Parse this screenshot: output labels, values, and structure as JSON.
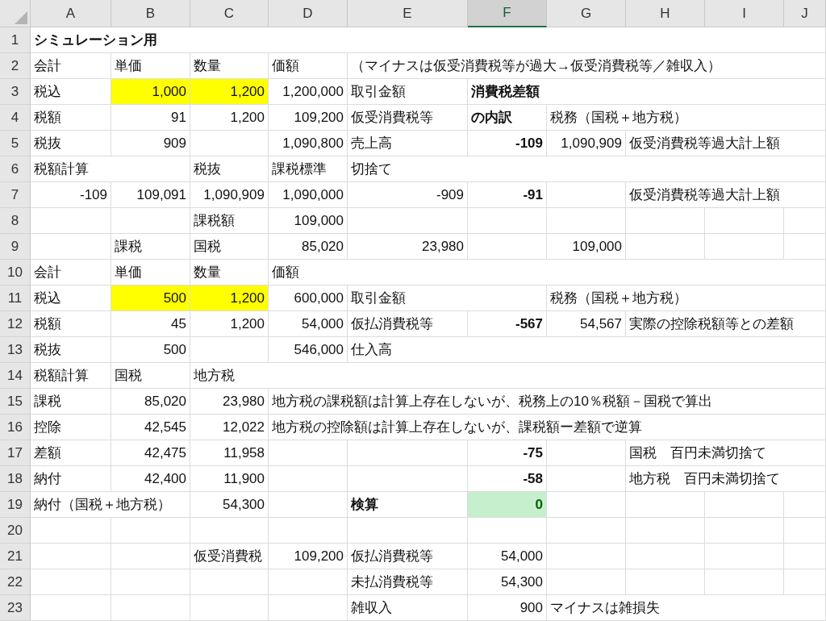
{
  "columns": [
    {
      "label": "A",
      "selected": false
    },
    {
      "label": "B",
      "selected": false
    },
    {
      "label": "C",
      "selected": false
    },
    {
      "label": "D",
      "selected": false
    },
    {
      "label": "E",
      "selected": false
    },
    {
      "label": "F",
      "selected": true
    },
    {
      "label": "G",
      "selected": false
    },
    {
      "label": "H",
      "selected": false
    },
    {
      "label": "I",
      "selected": false
    },
    {
      "label": "J",
      "selected": false
    }
  ],
  "rows": [
    {
      "number": "1",
      "A": {
        "text": "シミュレーション用",
        "bold": true
      }
    },
    {
      "number": "2",
      "A": {
        "text": "会計"
      },
      "B": {
        "text": "単価"
      },
      "C": {
        "text": "数量"
      },
      "D": {
        "text": "価額"
      },
      "E": {
        "text": "（マイナスは仮受消費税等が過大→仮受消費税等／雑収入）"
      }
    },
    {
      "number": "3",
      "A": {
        "text": "税込"
      },
      "B": {
        "text": "1,000",
        "right_aligned": true,
        "color": "#ffff00"
      },
      "C": {
        "text": "1,200",
        "right_aligned": true,
        "color": "#ffff00"
      },
      "D": {
        "text": "1,200,000",
        "right_aligned": true
      },
      "E": {
        "text": "取引金額"
      },
      "F": {
        "text": "消費税差額",
        "bold": true
      }
    },
    {
      "number": "4",
      "A": {
        "text": "税額"
      },
      "B": {
        "text": "91",
        "right_aligned": true
      },
      "C": {
        "text": "1,200",
        "right_aligned": true
      },
      "D": {
        "text": "109,200",
        "right_aligned": true
      },
      "E": {
        "text": "仮受消費税等"
      },
      "F": {
        "text": "の内訳",
        "bold": true
      },
      "G": {
        "text": "税務（国税＋地方税）"
      }
    },
    {
      "number": "5",
      "A": {
        "text": "税抜"
      },
      "B": {
        "text": "909",
        "right_aligned": true
      },
      "D": {
        "text": "1,090,800",
        "right_aligned": true
      },
      "E": {
        "text": "売上高"
      },
      "F": {
        "text": "-109",
        "right_aligned": true,
        "bold": true
      },
      "G": {
        "text": "1,090,909",
        "right_aligned": true
      },
      "H": {
        "text": "仮受消費税等過大計上額"
      }
    },
    {
      "number": "6",
      "A": {
        "text": "税額計算"
      },
      "C": {
        "text": "税抜"
      },
      "D": {
        "text": "課税標準"
      },
      "E": {
        "text": "切捨て"
      }
    },
    {
      "number": "7",
      "A": {
        "text": "-109",
        "right_aligned": true
      },
      "B": {
        "text": "109,091",
        "right_aligned": true
      },
      "C": {
        "text": "1,090,909",
        "right_aligned": true
      },
      "D": {
        "text": "1,090,000",
        "right_aligned": true
      },
      "E": {
        "text": "-909",
        "right_aligned": true
      },
      "F": {
        "text": "-91",
        "right_aligned": true,
        "bold": true
      },
      "H": {
        "text": "仮受消費税等過大計上額"
      }
    },
    {
      "number": "8",
      "C": {
        "text": "課税額"
      },
      "D": {
        "text": "109,000",
        "right_aligned": true
      }
    },
    {
      "number": "9",
      "B": {
        "text": "課税"
      },
      "C": {
        "text": "国税"
      },
      "D": {
        "text": "85,020",
        "right_aligned": true
      },
      "E": {
        "text": "23,980",
        "right_aligned": true
      },
      "G": {
        "text": "109,000",
        "right_aligned": true
      }
    },
    {
      "number": "10",
      "A": {
        "text": "会計"
      },
      "B": {
        "text": "単価"
      },
      "C": {
        "text": "数量"
      },
      "D": {
        "text": "価額"
      }
    },
    {
      "number": "11",
      "A": {
        "text": "税込"
      },
      "B": {
        "text": "500",
        "right_aligned": true,
        "color": "#ffff00"
      },
      "C": {
        "text": "1,200",
        "right_aligned": true,
        "color": "#ffff00"
      },
      "D": {
        "text": "600,000",
        "right_aligned": true
      },
      "E": {
        "text": "取引金額"
      },
      "G": {
        "text": "税務（国税＋地方税）"
      }
    },
    {
      "number": "12",
      "A": {
        "text": "税額"
      },
      "B": {
        "text": "45",
        "right_aligned": true
      },
      "C": {
        "text": "1,200",
        "right_aligned": true
      },
      "D": {
        "text": "54,000",
        "right_aligned": true
      },
      "E": {
        "text": "仮払消費税等"
      },
      "F": {
        "text": "-567",
        "right_aligned": true,
        "bold": true
      },
      "G": {
        "text": "54,567",
        "right_aligned": true
      },
      "H": {
        "text": "実際の控除税額等との差額"
      }
    },
    {
      "number": "13",
      "A": {
        "text": "税抜"
      },
      "B": {
        "text": "500",
        "right_aligned": true
      },
      "D": {
        "text": "546,000",
        "right_aligned": true
      },
      "E": {
        "text": "仕入高"
      }
    },
    {
      "number": "14",
      "A": {
        "text": "税額計算"
      },
      "B": {
        "text": "国税"
      },
      "C": {
        "text": "地方税"
      }
    },
    {
      "number": "15",
      "A": {
        "text": "課税"
      },
      "B": {
        "text": "85,020",
        "right_aligned": true
      },
      "C": {
        "text": "23,980",
        "right_aligned": true
      },
      "D": {
        "text": "地方税の課税額は計算上存在しないが、税務上の10％税額－国税で算出"
      }
    },
    {
      "number": "16",
      "A": {
        "text": "控除"
      },
      "B": {
        "text": "42,545",
        "right_aligned": true
      },
      "C": {
        "text": "12,022",
        "right_aligned": true
      },
      "D": {
        "text": "地方税の控除額は計算上存在しないが、課税額ー差額で逆算"
      }
    },
    {
      "number": "17",
      "A": {
        "text": "差額"
      },
      "B": {
        "text": "42,475",
        "right_aligned": true
      },
      "C": {
        "text": "11,958",
        "right_aligned": true
      },
      "F": {
        "text": "-75",
        "right_aligned": true,
        "bold": true
      },
      "H": {
        "text": "国税　百円未満切捨て"
      }
    },
    {
      "number": "18",
      "A": {
        "text": "納付"
      },
      "B": {
        "text": "42,400",
        "right_aligned": true
      },
      "C": {
        "text": "11,900",
        "right_aligned": true
      },
      "F": {
        "text": "-58",
        "right_aligned": true,
        "bold": true
      },
      "H": {
        "text": "地方税　百円未満切捨て"
      }
    },
    {
      "number": "19",
      "A": {
        "text": "納付（国税＋地方税）"
      },
      "C": {
        "text": "54,300",
        "right_aligned": true
      },
      "E": {
        "text": "検算",
        "bold": true
      },
      "F": {
        "text": "0",
        "right_aligned": true,
        "bold": true,
        "kind": "good"
      }
    },
    {
      "number": "20"
    },
    {
      "number": "21",
      "C": {
        "text": "仮受消費税"
      },
      "D": {
        "text": "109,200",
        "right_aligned": true
      },
      "E": {
        "text": "仮払消費税等"
      },
      "F": {
        "text": "54,000",
        "right_aligned": true
      }
    },
    {
      "number": "22",
      "E": {
        "text": "未払消費税等"
      },
      "F": {
        "text": "54,300",
        "right_aligned": true
      }
    },
    {
      "number": "23",
      "E": {
        "text": "雑収入"
      },
      "F": {
        "text": "900",
        "right_aligned": true
      },
      "G": {
        "text": "マイナスは雑損失"
      }
    }
  ]
}
